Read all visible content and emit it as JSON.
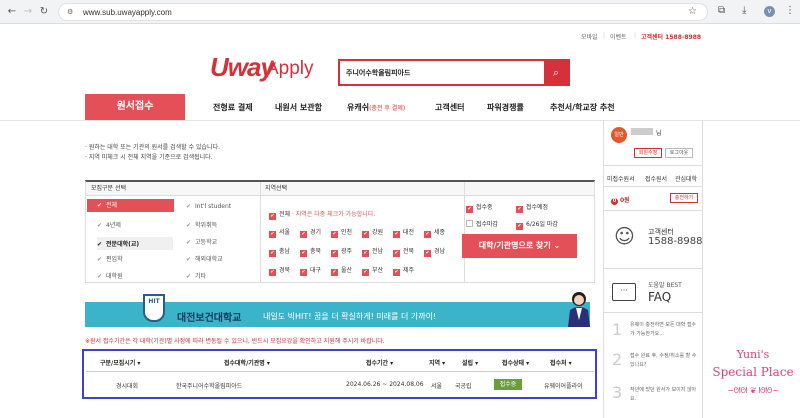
{
  "browser": {
    "url": "www.sub.uwayapply.com",
    "avatar_letter": "v"
  },
  "util_links": [
    "모바일",
    "이벤트"
  ],
  "util_call": "고객센터 1588-8988",
  "logo": {
    "brand": "Uway",
    "sub": "Apply"
  },
  "search": {
    "value": "주니어수학올림피아드"
  },
  "nav": {
    "active": "원서접수",
    "items": [
      "전형료 결제",
      "내원서 보관함",
      "유캐쉬",
      "고객센터",
      "파워경쟁률",
      "추천서/학교장 추천"
    ],
    "ucash_sub": "(충전 후 결제)"
  },
  "notes": [
    "· 원하는 대학 또는 기관의 원서를 검색할 수 있습니다.",
    "· 지역 미체크 시 전체 지역을 기준으로 검색됩니다."
  ],
  "filter": {
    "col1_header": "모집구분 선택",
    "col2_header": "지역선택",
    "col1": [
      "전체",
      "4년제",
      "전문대학(교)",
      "편입학",
      "대학원"
    ],
    "col1b": [
      "Int'l student",
      "학위취득",
      "고등학교",
      "해외대학교",
      "기타"
    ],
    "region_all": "전체",
    "region_note": "· 지역은 다중 체크가 가능합니다.",
    "regions_row1": [
      "서울",
      "경기",
      "인천",
      "강원",
      "대전",
      "세종"
    ],
    "regions_row2": [
      "충남",
      "충북",
      "광주",
      "전남",
      "전북",
      "경남"
    ],
    "regions_row3": [
      "경북",
      "대구",
      "울산",
      "부산",
      "제주"
    ],
    "status_opts": [
      "접수중",
      "접수예정",
      "접수마감",
      "6/26일 마감"
    ],
    "find_button": "대학/기관명으로 찾기"
  },
  "banner": {
    "logo": "HIT",
    "title": "대전보건대학교",
    "slogan": "내일도 빅HIT! 꿈을 더 확실하게! 미래를 더 가까이!"
  },
  "warning": "※원서 접수기간은 각 대학(기관)별 사정에 따라 변동될 수 있으니, 반드시 모집요강을 확인하고 지원해 주시기 바랍니다.",
  "results": {
    "headers": [
      "구분/모집시기",
      "접수대학/기관명",
      "접수기간",
      "지역",
      "설립",
      "접수상태",
      "접수처"
    ],
    "rows": [
      [
        "경시대회",
        "한국주니어수학올림피아드",
        "2024.06.26 ~ 2024.08.06",
        "서울",
        "국공립",
        "접수중",
        "유웨이어플라이"
      ]
    ]
  },
  "sidebar": {
    "badge": "일반",
    "name_suffix": "님",
    "btn_info": "회원수정",
    "btn_logout": "로그아웃",
    "tabs": [
      "미접수원서",
      "접수원서",
      "관심대학"
    ],
    "count": "0",
    "count_unit": "0원",
    "charge": "충전하기",
    "cc_label": "고객센터",
    "cc_phone": "1588-8988",
    "faq_label": "도움말 BEST",
    "faq_title": "FAQ",
    "faq_items": [
      {
        "num": "1",
        "text": "유웨이 충전하면 모든 대학 접수가 가능한가요..."
      },
      {
        "num": "2",
        "text": "접수 완료 후, 수정/취소를 할 수 있나요?"
      },
      {
        "num": "3",
        "text": "작년에 썼던 원서가 보이지 않아요."
      }
    ]
  },
  "watermark": {
    "line1": "Yuni's",
    "line2": "Special Place",
    "line3": "~ᘛᘛ ❦ ᘚᘚ~"
  },
  "colors": {
    "brand_red": "#d6303a",
    "accent": "#e35057",
    "banner": "#3bb3c9",
    "status_green": "#6a9e3c",
    "highlight_box": "#3f3fd0"
  }
}
